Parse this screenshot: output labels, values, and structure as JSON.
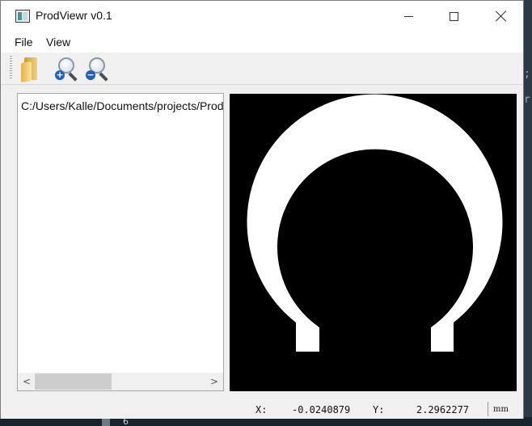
{
  "window": {
    "title": "ProdViewr v0.1"
  },
  "menu": {
    "items": [
      "File",
      "View"
    ]
  },
  "toolbar": {
    "buttons": [
      "open-folder",
      "zoom-in",
      "zoom-out"
    ],
    "zoom_in_badge": "+",
    "zoom_out_badge": "−"
  },
  "file_panel": {
    "path": "C:/Users/Kalle/Documents/projects/ProdViewr"
  },
  "scrollbar": {
    "left_arrow": "<",
    "right_arrow": ">"
  },
  "status": {
    "x_label": "X:",
    "x_value": "-0.0240879",
    "y_label": "Y:",
    "y_value": "2.2962277",
    "unit": "mm"
  },
  "colors": {
    "canvas_bg": "#000000",
    "shape_fill": "#ffffff"
  },
  "background": {
    "bottom_number": "6"
  }
}
